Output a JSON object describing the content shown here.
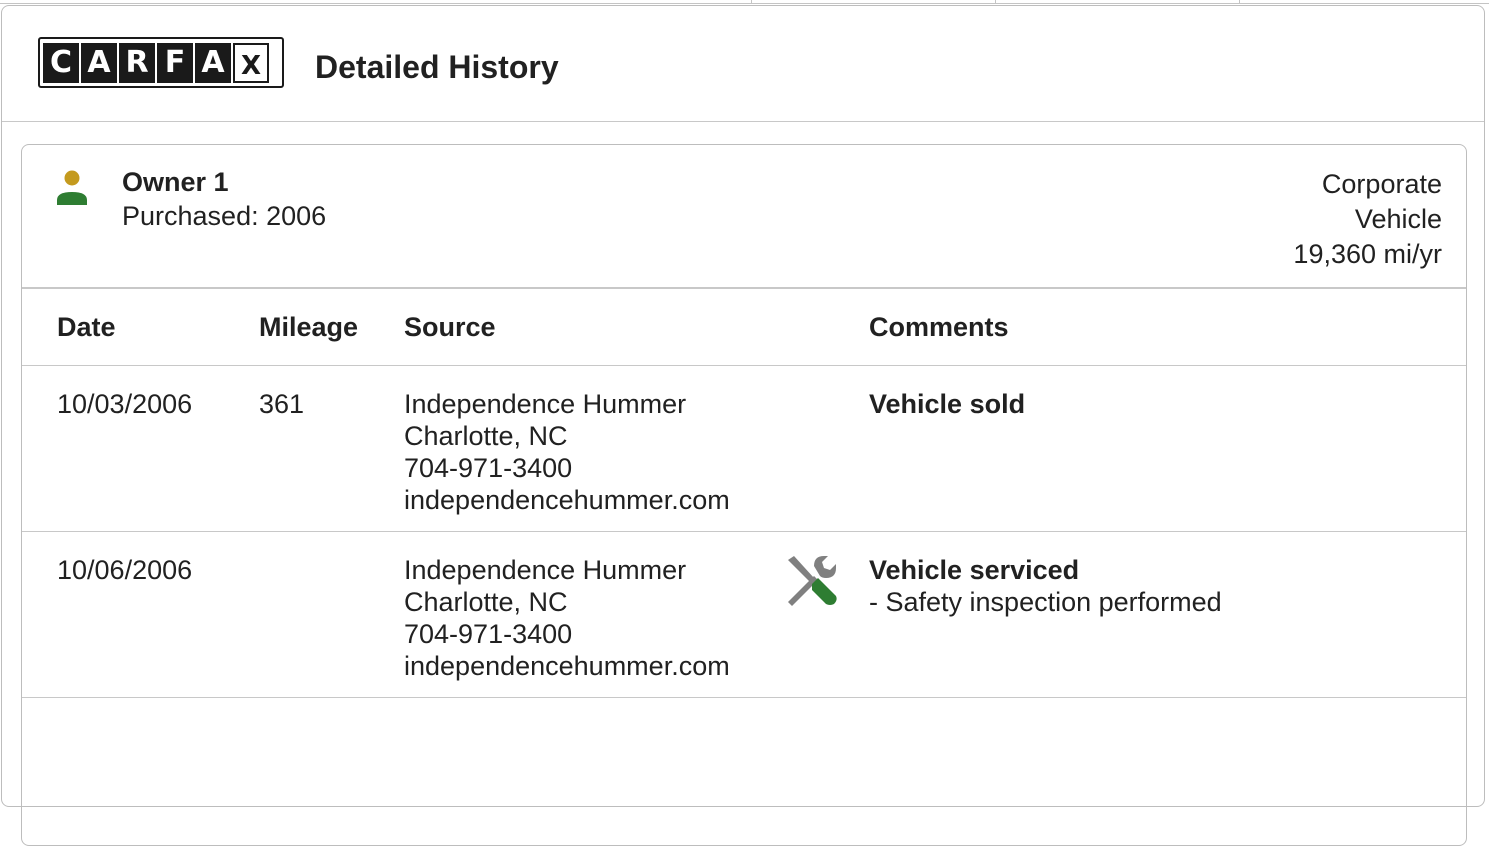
{
  "header": {
    "logo_letters": [
      "C",
      "A",
      "R",
      "F",
      "A",
      "X"
    ],
    "title": "Detailed History"
  },
  "owner": {
    "name": "Owner 1",
    "purchased": "Purchased: 2006",
    "type_line1": "Corporate",
    "type_line2": "Vehicle",
    "mileage_rate": "19,360 mi/yr",
    "icon": "person-icon"
  },
  "table": {
    "headers": [
      "Date",
      "Mileage",
      "Source",
      "Comments"
    ],
    "rows": [
      {
        "date": "10/03/2006",
        "mileage": "361",
        "source": [
          "Independence Hummer",
          "Charlotte, NC",
          "704-971-3400",
          "independencehummer.com"
        ],
        "icon": "",
        "comment_title": "Vehicle sold",
        "comment_detail": ""
      },
      {
        "date": "10/06/2006",
        "mileage": "",
        "source": [
          "Independence Hummer",
          "Charlotte, NC",
          "704-971-3400",
          "independencehummer.com"
        ],
        "icon": "service-tools-icon",
        "comment_title": "Vehicle serviced",
        "comment_detail": "- Safety inspection performed"
      }
    ]
  },
  "colors": {
    "person_head": "#c49a1e",
    "person_body": "#2e7d32",
    "tool_gray": "#808080",
    "tool_green": "#2e7d32"
  }
}
